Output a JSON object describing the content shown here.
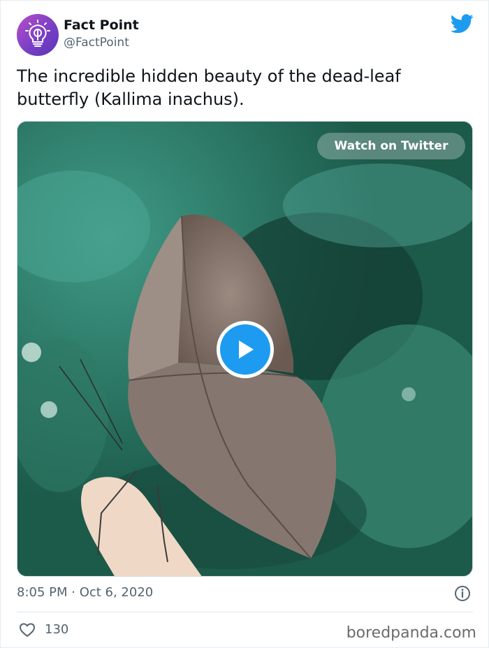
{
  "author": {
    "name": "Fact Point",
    "handle": "@FactPoint",
    "avatar_icon": "lightbulb-icon",
    "avatar_color": "#8e44c8"
  },
  "tweet": {
    "text": "The incredible hidden beauty of the dead-leaf butterfly (Kallima inachus).",
    "timestamp": "8:05 PM · Oct 6, 2020",
    "likes": "130"
  },
  "media": {
    "watch_label": "Watch on Twitter",
    "play_icon": "play-icon"
  },
  "icons": {
    "brand": "twitter-bird-icon",
    "info": "info-icon",
    "like": "heart-icon"
  },
  "watermark": "boredpanda.com",
  "colors": {
    "twitter_blue": "#1d9bf0",
    "secondary_text": "#536471"
  }
}
